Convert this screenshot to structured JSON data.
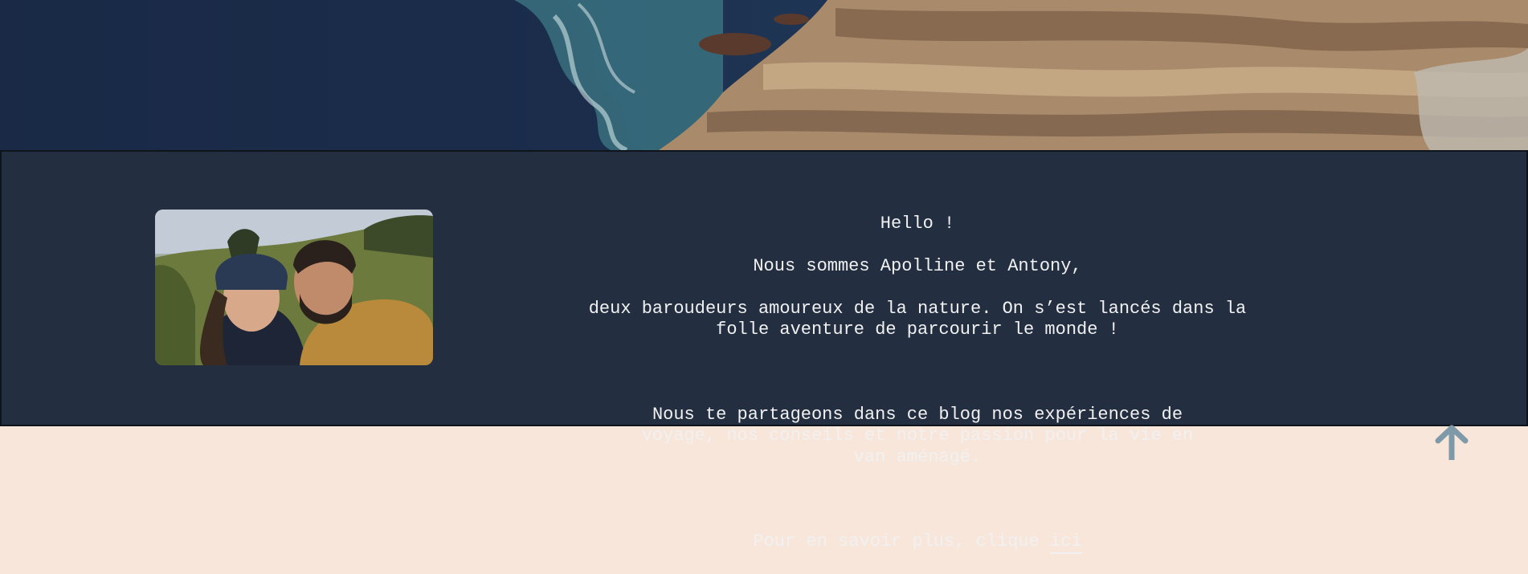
{
  "hero": {
    "image": "coastline-rocks-ocean-photo"
  },
  "about": {
    "photo": {
      "image": "couple-selfie-photo"
    },
    "greeting": "Hello !",
    "intro_line1": "Nous sommes Apolline et Antony,",
    "intro_line2": "deux baroudeurs amoureux de la nature. On s’est lancés dans la folle aventure de parcourir le monde !",
    "paragraph2": "Nous te partageons dans ce blog nos expériences de voyage, nos conseils et notre passion pour la vie en van aménagé.",
    "more_prefix": "Pour en savoir plus, clique ",
    "more_link": "ici"
  },
  "scroll_top": {
    "icon": "arrow-up-icon"
  },
  "colors": {
    "page_bg": "#f8e6da",
    "about_bg": "#232f40",
    "text": "#f1f1f1",
    "arrow": "#7e9aa8"
  }
}
